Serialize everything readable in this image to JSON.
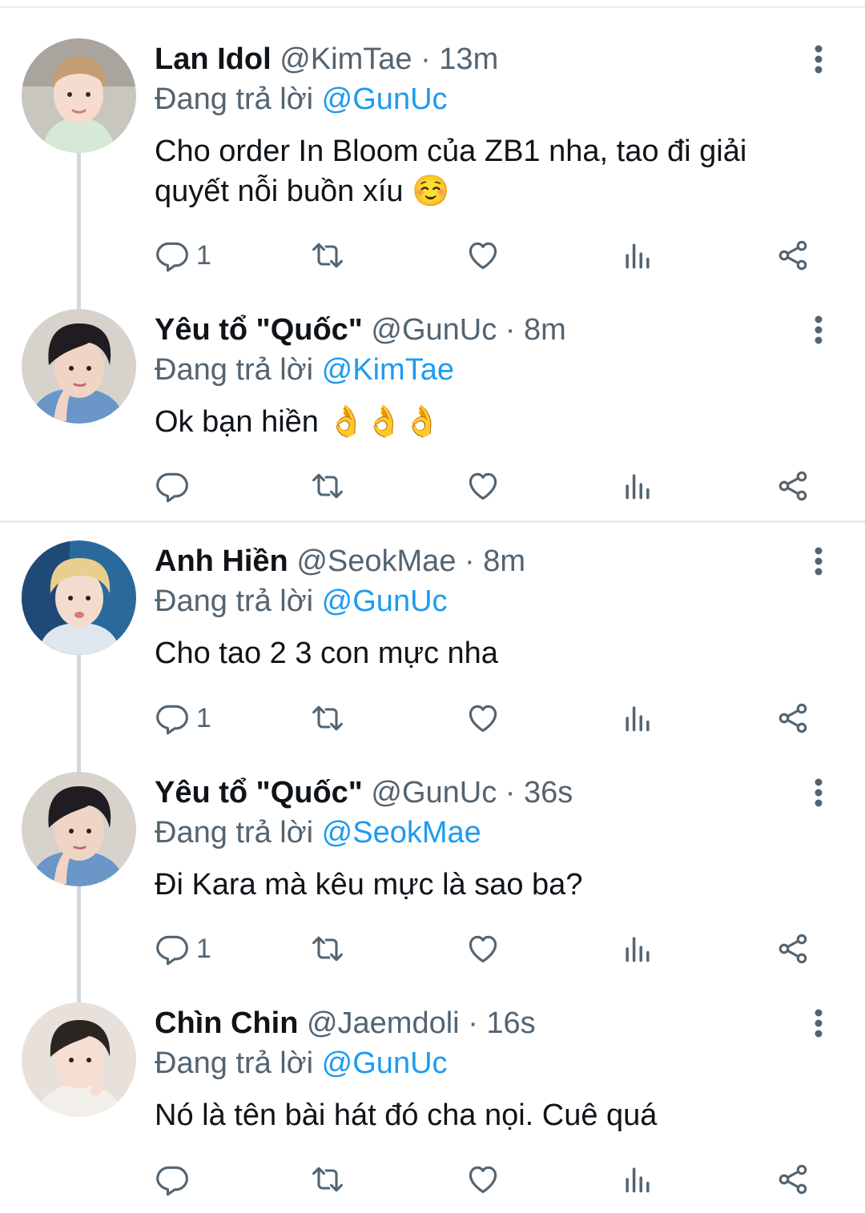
{
  "colors": {
    "link": "#1d9bf0",
    "muted": "#536471",
    "text": "#0f1419",
    "divider": "#e6ecf0",
    "thread_line": "#cfd9de"
  },
  "icons": {
    "reply": "reply-icon",
    "retweet": "retweet-icon",
    "like": "heart-icon",
    "views": "views-icon",
    "share": "share-icon",
    "more": "more-vertical-icon"
  },
  "reply_prefix": "Đang trả lời",
  "tweets": [
    {
      "name": "Lan Idol",
      "handle": "@KimTae",
      "time": "13m",
      "reply_to": "@GunUc",
      "text": "Cho order In Bloom của ZB1 nha, tao đi giải quyết nỗi buồn xíu ☺️",
      "replies": "1"
    },
    {
      "name": "Yêu tổ \"Quốc\"",
      "handle": "@GunUc",
      "time": "8m",
      "reply_to": "@KimTae",
      "text": "Ok bạn hiền 👌👌👌",
      "replies": ""
    },
    {
      "name": "Anh Hiền",
      "handle": "@SeokMae",
      "time": "8m",
      "reply_to": "@GunUc",
      "text": "Cho tao 2 3 con mực nha",
      "replies": "1"
    },
    {
      "name": "Yêu tổ \"Quốc\"",
      "handle": "@GunUc",
      "time": "36s",
      "reply_to": "@SeokMae",
      "text": "Đi Kara mà kêu mực là sao ba?",
      "replies": "1"
    },
    {
      "name": "Chìn Chin",
      "handle": "@Jaemdoli",
      "time": "16s",
      "reply_to": "@GunUc",
      "text": "Nó là tên bài hát đó cha nọi. Cuê quá",
      "replies": ""
    }
  ]
}
